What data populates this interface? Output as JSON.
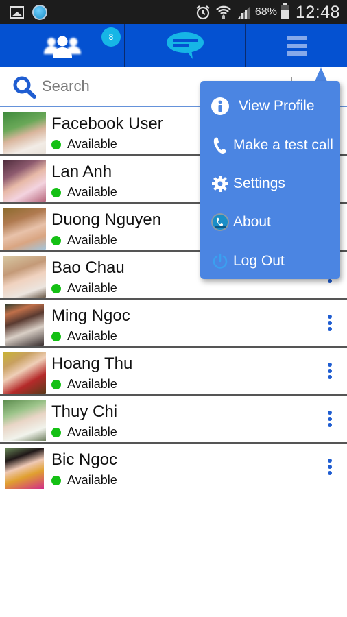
{
  "status_bar": {
    "battery": "68%",
    "time": "12:48",
    "icons": [
      "gallery-icon",
      "app-notification-icon",
      "alarm-icon",
      "wifi-icon",
      "signal-icon",
      "battery-icon"
    ]
  },
  "tabs": [
    {
      "name": "contacts",
      "icon": "contacts-icon",
      "badge": "8"
    },
    {
      "name": "messages",
      "icon": "chat-bubble-icon"
    },
    {
      "name": "menu",
      "icon": "hamburger-menu-icon"
    }
  ],
  "search": {
    "placeholder": "Search",
    "value": ""
  },
  "contacts": [
    {
      "name": "Facebook User",
      "status": "Available"
    },
    {
      "name": "Lan Anh",
      "status": "Available"
    },
    {
      "name": "Duong Nguyen",
      "status": "Available"
    },
    {
      "name": "Bao Chau",
      "status": "Available"
    },
    {
      "name": "Ming Ngoc",
      "status": "Available"
    },
    {
      "name": "Hoang Thu",
      "status": "Available"
    },
    {
      "name": "Thuy Chi",
      "status": "Available"
    },
    {
      "name": "Bic Ngoc",
      "status": "Available"
    }
  ],
  "menu": {
    "items": [
      {
        "label": "View Profile",
        "icon": "info-icon"
      },
      {
        "label": "Make a test call",
        "icon": "phone-icon"
      },
      {
        "label": "Settings",
        "icon": "gear-icon"
      },
      {
        "label": "About",
        "icon": "app-logo-icon"
      },
      {
        "label": "Log Out",
        "icon": "power-icon"
      }
    ]
  },
  "colors": {
    "primary": "#0451d1",
    "badge": "#16b6e6",
    "menu_bg": "#4b85e2",
    "available": "#14c014",
    "status_bar": "#1c1c1c"
  }
}
